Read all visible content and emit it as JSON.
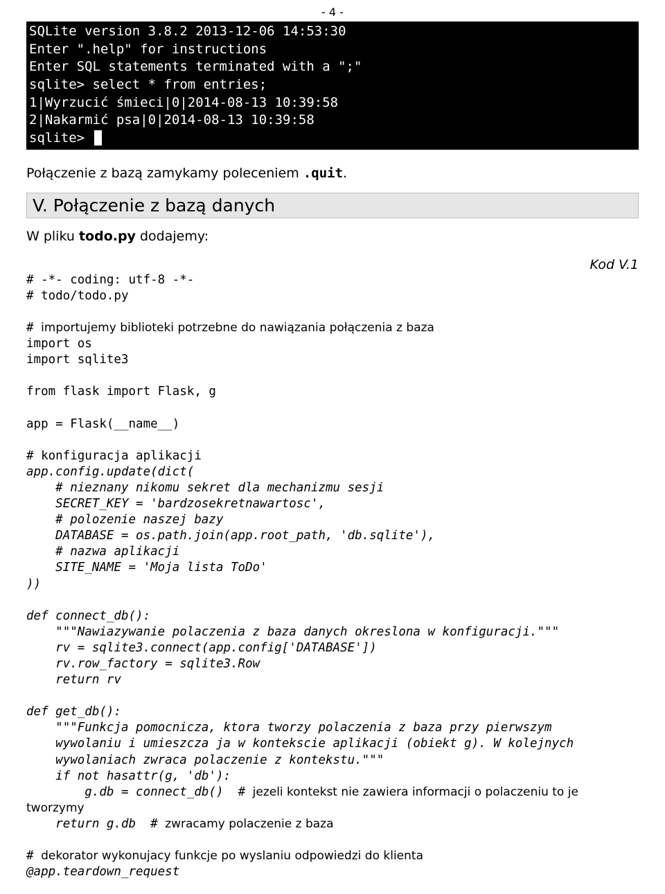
{
  "page_number": "- 4 -",
  "terminal": {
    "lines": [
      "SQLite version 3.8.2 2013-12-06 14:53:30",
      "Enter \".help\" for instructions",
      "Enter SQL statements terminated with a \";\"",
      "sqlite> select * from entries;",
      "1|Wyrzucić śmieci|0|2014-08-13 10:39:58",
      "2|Nakarmić psa|0|2014-08-13 10:39:58",
      "sqlite> "
    ]
  },
  "para1": {
    "pre": "Połączenie z bazą zamykamy poleceniem ",
    "cmd": ".quit",
    "post": "."
  },
  "section_heading": "V. Połączenie z bazą danych",
  "para2": {
    "pre": "W pliku ",
    "file": "todo.py",
    "post": " dodajemy:"
  },
  "kod_label": "Kod V.1",
  "code": {
    "l01": "# -*- coding: utf-8 -*-",
    "l02": "# todo/todo.py",
    "l03_hash": "# ",
    "l03_cmt": "importujemy biblioteki potrzebne do nawiązania połączenia z baza",
    "l04": "import os",
    "l05": "import sqlite3",
    "l06": "from flask import Flask, g",
    "l07": "app = Flask(__name__)",
    "l08": "# konfiguracja aplikacji",
    "l09": "app.config.update(dict(",
    "l10": "    # nieznany nikomu sekret dla mechanizmu sesji",
    "l11": "    SECRET_KEY = 'bardzosekretnawartosc',",
    "l12": "    # polozenie naszej bazy",
    "l13": "    DATABASE = os.path.join(app.root_path, 'db.sqlite'),",
    "l14": "    # nazwa aplikacji",
    "l15": "    SITE_NAME = 'Moja lista ToDo'",
    "l16": "))",
    "l17": "def connect_db():",
    "l18": "    \"\"\"Nawiazywanie polaczenia z baza danych okreslona w konfiguracji.\"\"\"",
    "l19": "    rv = sqlite3.connect(app.config['DATABASE'])",
    "l20": "    rv.row_factory = sqlite3.Row",
    "l21": "    return rv",
    "l22": "def get_db():",
    "l23": "    \"\"\"Funkcja pomocnicza, ktora tworzy polaczenia z baza przy pierwszym",
    "l24": "    wywolaniu i umieszcza ja w kontekscie aplikacji (obiekt g). W kolejnych",
    "l25": "    wywolaniach zwraca polaczenie z kontekstu.\"\"\"",
    "l26": "    if not hasattr(g, 'db'):",
    "l27a": "        g.db = connect_db()  ",
    "l27_hash": "# ",
    "l27_cmt": "jezeli kontekst nie zawiera informacji o polaczeniu to je tworzymy",
    "l28a": "    return g.db  ",
    "l28_hash": "# ",
    "l28_cmt": "zwracamy polaczenie z baza",
    "l29_hash": "# ",
    "l29_cmt": "dekorator wykonujacy funkcje po wyslaniu odpowiedzi do klienta",
    "l30": "@app.teardown_request"
  }
}
